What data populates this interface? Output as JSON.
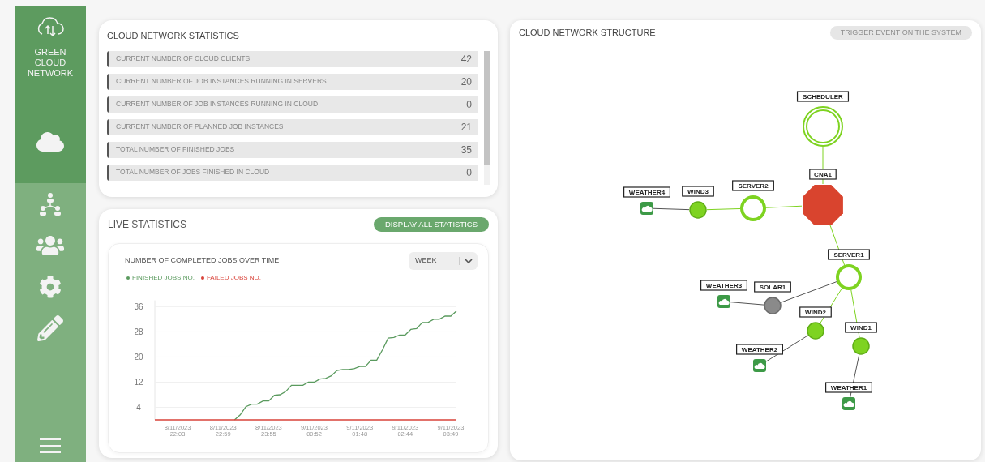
{
  "sidebar": {
    "logo_text": "GREEN CLOUD NETWORK",
    "items": [
      {
        "kind": "cloud",
        "selected": true
      },
      {
        "kind": "agents",
        "selected": false
      },
      {
        "kind": "clients",
        "selected": false
      },
      {
        "kind": "settings",
        "selected": false
      },
      {
        "kind": "edit",
        "selected": false
      }
    ]
  },
  "statistics": {
    "title": "CLOUD NETWORK STATISTICS",
    "rows": [
      {
        "label": "CURRENT NUMBER OF CLOUD CLIENTS",
        "value": "42"
      },
      {
        "label": "CURRENT NUMBER OF JOB INSTANCES RUNNING IN SERVERS",
        "value": "20"
      },
      {
        "label": "CURRENT NUMBER OF JOB INSTANCES RUNNING IN CLOUD",
        "value": "0"
      },
      {
        "label": "CURRENT NUMBER OF PLANNED JOB INSTANCES",
        "value": "21"
      },
      {
        "label": "TOTAL NUMBER OF FINISHED JOBS",
        "value": "35"
      },
      {
        "label": "TOTAL NUMBER OF JOBS FINISHED IN CLOUD",
        "value": "0"
      }
    ]
  },
  "live_statistics": {
    "title": "LIVE STATISTICS",
    "button": "DISPLAY ALL STATISTICS",
    "chart": {
      "title": "NUMBER OF COMPLETED JOBS OVER TIME",
      "period": "WEEK",
      "chart_data": {
        "type": "line",
        "categories": [
          null,
          null,
          null,
          null,
          "8/11/2023 22:03",
          null,
          null,
          null,
          null,
          null,
          null,
          null,
          "8/11/2023 22:59",
          null,
          null,
          null,
          null,
          null,
          null,
          null,
          "8/11/2023 23:55",
          null,
          null,
          null,
          null,
          null,
          null,
          null,
          "9/11/2023 00:52",
          null,
          null,
          null,
          null,
          null,
          null,
          null,
          "9/11/2023 01:48",
          null,
          null,
          null,
          null,
          null,
          null,
          null,
          "9/11/2023 02:44",
          null,
          null,
          null,
          null,
          null,
          null,
          null,
          "9/11/2023 03:49",
          null
        ],
        "series": [
          {
            "name": "FINISHED JOBS NO.",
            "color": "#5a9a5e",
            "values": [
              null,
              null,
              null,
              null,
              null,
              null,
              null,
              null,
              null,
              null,
              null,
              null,
              null,
              null,
              0,
              1.6,
              4.2,
              5,
              5,
              6,
              6,
              7.8,
              8,
              9,
              11,
              11,
              11,
              12,
              12,
              13,
              13.2,
              14,
              15.7,
              16,
              16,
              16.3,
              17,
              17,
              19,
              19,
              22.3,
              26,
              26.2,
              27,
              27,
              28.8,
              29,
              31,
              31,
              32,
              32,
              33,
              33,
              34.6
            ]
          },
          {
            "name": "FAILED JOBS NO.",
            "color": "#d9433a",
            "values": [
              0,
              0,
              0,
              0,
              0,
              0,
              0,
              0,
              0,
              0,
              0,
              0,
              0,
              0,
              0,
              0,
              0,
              0,
              0,
              0,
              0,
              0,
              0,
              0,
              0,
              0,
              0,
              0,
              0,
              0,
              0,
              0,
              0,
              0,
              0,
              0,
              0,
              0,
              0,
              0,
              0,
              0,
              0,
              0,
              0,
              0,
              0,
              0,
              0,
              0,
              0,
              0,
              0,
              0
            ]
          }
        ],
        "grid": true,
        "ylim": [
          0,
          38
        ],
        "yticks": [
          4,
          12,
          20,
          28,
          36
        ]
      }
    }
  },
  "network": {
    "title": "CLOUD NETWORK STRUCTURE",
    "trigger_button": {
      "label": "TRIGGER EVENT ON THE SYSTEM",
      "disabled": true
    },
    "nodes": [
      {
        "kind": "scheduler",
        "label": "SCHEDULER"
      },
      {
        "kind": "agent",
        "label": "CNA1"
      },
      {
        "kind": "server",
        "label": "SERVER2"
      },
      {
        "kind": "source",
        "label": "WIND3",
        "active": true
      },
      {
        "kind": "weather",
        "label": "WEATHER4"
      },
      {
        "kind": "server",
        "label": "SERVER1"
      },
      {
        "kind": "source",
        "label": "SOLAR1",
        "active": false
      },
      {
        "kind": "weather",
        "label": "WEATHER3"
      },
      {
        "kind": "source",
        "label": "WIND2",
        "active": true
      },
      {
        "kind": "weather",
        "label": "WEATHER2"
      },
      {
        "kind": "source",
        "label": "WIND1",
        "active": true
      },
      {
        "kind": "weather",
        "label": "WEATHER1"
      }
    ]
  }
}
